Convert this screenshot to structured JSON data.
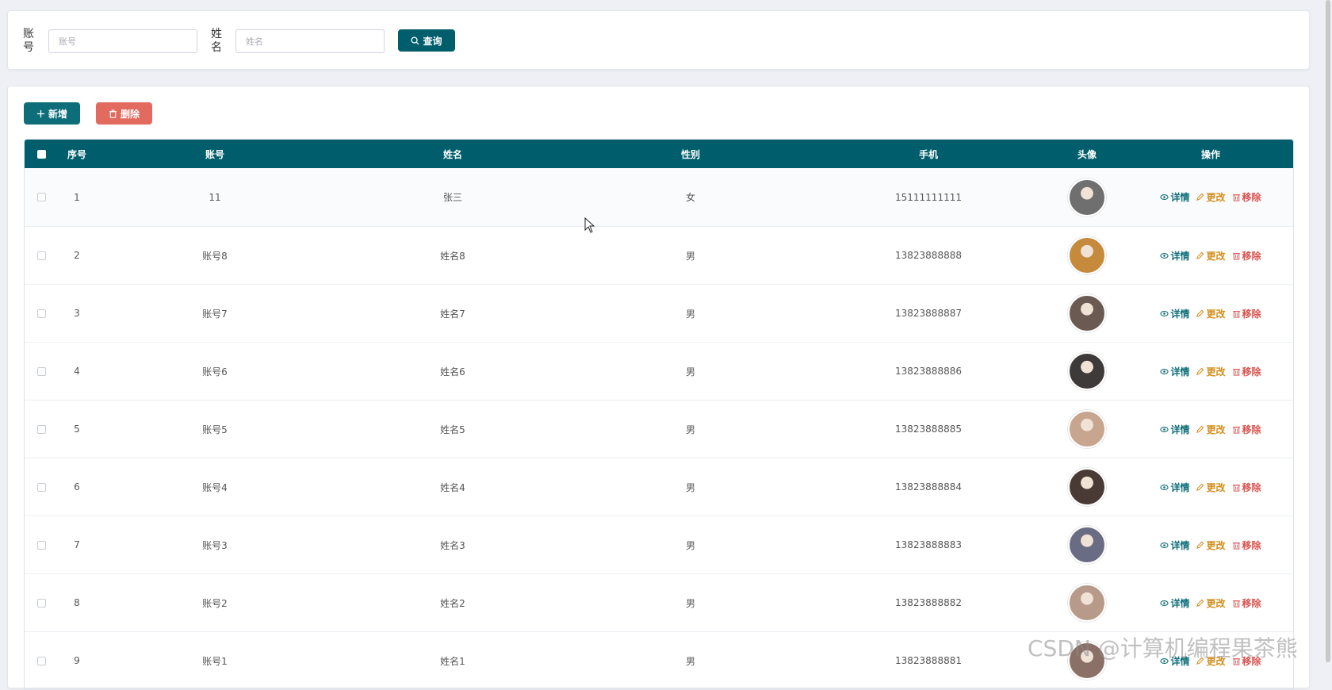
{
  "search": {
    "account_label": "账号",
    "account_placeholder": "账号",
    "name_label": "姓名",
    "name_placeholder": "姓名",
    "query_button": "查询"
  },
  "toolbar": {
    "add_button": "新增",
    "delete_button": "删除"
  },
  "table": {
    "columns": [
      "序号",
      "账号",
      "姓名",
      "性别",
      "手机",
      "头像",
      "操作"
    ],
    "actions": {
      "detail": "详情",
      "edit": "更改",
      "remove": "移除"
    },
    "rows": [
      {
        "idx": "1",
        "account": "11",
        "name": "张三",
        "sex": "女",
        "phone": "15111111111",
        "avatar_color": "#6f6f6f"
      },
      {
        "idx": "2",
        "account": "账号8",
        "name": "姓名8",
        "sex": "男",
        "phone": "13823888888",
        "avatar_color": "#c58a3c"
      },
      {
        "idx": "3",
        "account": "账号7",
        "name": "姓名7",
        "sex": "男",
        "phone": "13823888887",
        "avatar_color": "#6b5a52"
      },
      {
        "idx": "4",
        "account": "账号6",
        "name": "姓名6",
        "sex": "男",
        "phone": "13823888886",
        "avatar_color": "#3e3a3a"
      },
      {
        "idx": "5",
        "account": "账号5",
        "name": "姓名5",
        "sex": "男",
        "phone": "13823888885",
        "avatar_color": "#c7a58e"
      },
      {
        "idx": "6",
        "account": "账号4",
        "name": "姓名4",
        "sex": "男",
        "phone": "13823888884",
        "avatar_color": "#4a3a36"
      },
      {
        "idx": "7",
        "account": "账号3",
        "name": "姓名3",
        "sex": "男",
        "phone": "13823888883",
        "avatar_color": "#6a6c84"
      },
      {
        "idx": "8",
        "account": "账号2",
        "name": "姓名2",
        "sex": "男",
        "phone": "13823888882",
        "avatar_color": "#b89a8a"
      },
      {
        "idx": "9",
        "account": "账号1",
        "name": "姓名1",
        "sex": "男",
        "phone": "13823888881",
        "avatar_color": "#8a7066"
      }
    ]
  },
  "watermark": "CSDN @计算机编程果茶熊",
  "colors": {
    "primary": "#005e6c",
    "danger": "#e26a5e",
    "edit": "#d48e1c",
    "remove": "#d9534f"
  }
}
